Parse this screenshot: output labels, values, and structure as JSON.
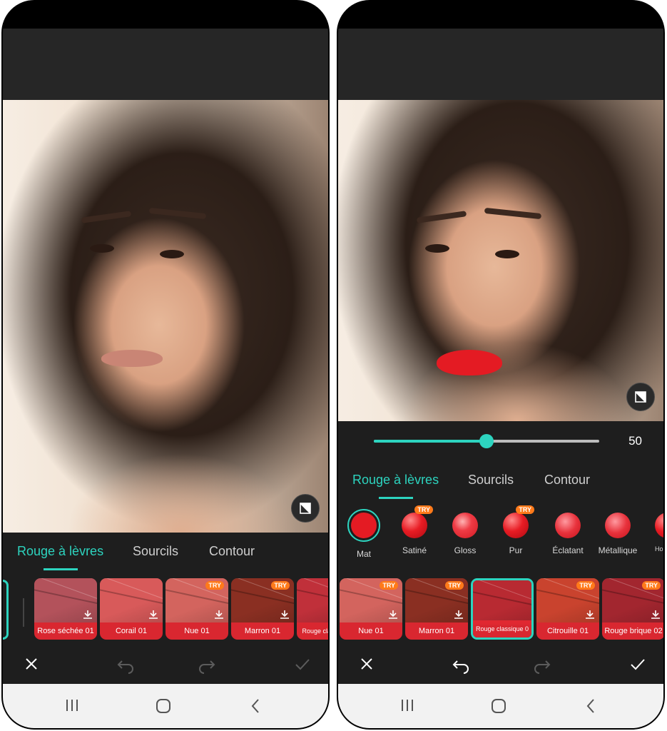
{
  "screens": {
    "left": {
      "tabs": [
        "Rouge à lèvres",
        "Sourcils",
        "Contour"
      ],
      "swatches": [
        {
          "name": "Rose séchée 01",
          "try": false,
          "color": "#b3525b"
        },
        {
          "name": "Corail 01",
          "try": false,
          "color": "#d85a5a"
        },
        {
          "name": "Nue 01",
          "try": true,
          "color": "#d3645e"
        },
        {
          "name": "Marron 01",
          "try": true,
          "color": "#8a2f22"
        },
        {
          "name": "Rouge clas",
          "try": false,
          "color": "#c0303a"
        }
      ],
      "try_label": "TRY"
    },
    "right": {
      "slider_value": "50",
      "slider_fraction": 0.5,
      "tabs": [
        "Rouge à lèvres",
        "Sourcils",
        "Contour"
      ],
      "finishes": [
        {
          "name": "Mat",
          "try": false
        },
        {
          "name": "Satiné",
          "try": true
        },
        {
          "name": "Gloss",
          "try": false
        },
        {
          "name": "Pur",
          "try": true
        },
        {
          "name": "Éclatant",
          "try": false
        },
        {
          "name": "Métallique",
          "try": false
        },
        {
          "name": "Ho ph",
          "try": false
        }
      ],
      "swatches": [
        {
          "name": "Nue 01",
          "try": true,
          "color": "#d3645e"
        },
        {
          "name": "Marron 01",
          "try": true,
          "color": "#8a2f22"
        },
        {
          "name": "Rouge classique 0",
          "try": false,
          "color": "#b82a32"
        },
        {
          "name": "Citrouille 01",
          "try": true,
          "color": "#c9432e"
        },
        {
          "name": "Rouge brique 02",
          "try": true,
          "color": "#a2262f"
        }
      ],
      "try_label": "TRY"
    }
  },
  "colors": {
    "accent": "#2dd4bf",
    "lip_red": "#e41b23",
    "try_badge": "#ff7a1a"
  },
  "icons": [
    "close-icon",
    "undo-icon",
    "redo-icon",
    "check-icon",
    "compare-icon",
    "download-icon",
    "recent-apps-icon",
    "home-icon",
    "back-icon"
  ]
}
